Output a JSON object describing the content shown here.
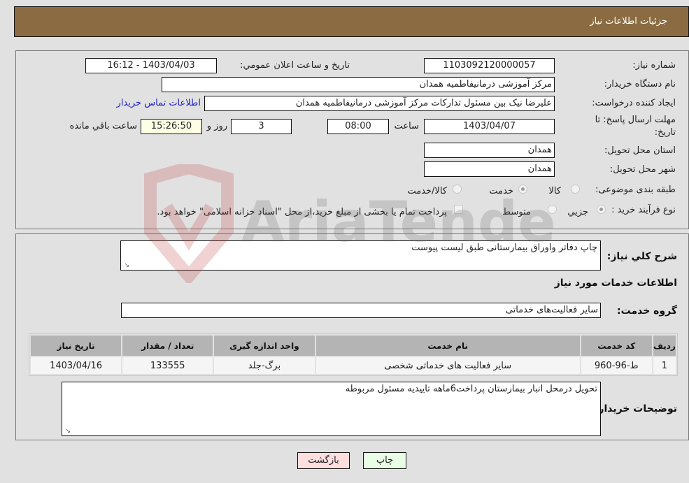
{
  "header": {
    "title": "جزئیات اطلاعات نیاز"
  },
  "fields": {
    "need_number_label": "شماره نیاز:",
    "need_number": "1103092120000057",
    "announce_label": "تاريخ و ساعت اعلان عمومي:",
    "announce_value": "1403/04/03 - 16:12",
    "buyer_org_label": "نام دستگاه خریدار:",
    "buyer_org": "مرکز آموزشی درمانیفاطمیه همدان",
    "creator_label": "ایجاد کننده درخواست:",
    "creator": "علیرضا نیک بین مسئول تدارکات مرکز آموزشی درمانیفاطمیه همدان",
    "contact_link": "اطلاعات تماس خریدار",
    "deadline_label": "مهلت ارسال پاسخ: تا تاریخ:",
    "deadline_date": "1403/04/07",
    "time_label": "ساعت",
    "deadline_time": "08:00",
    "days_value": "3",
    "days_label": "روز و",
    "remaining_time": "15:26:50",
    "remaining_label": "ساعت باقي مانده",
    "province_label": "استان محل تحویل:",
    "province": "همدان",
    "city_label": "شهر محل تحویل:",
    "city": "همدان",
    "category_label": "طبقه بندی موضوعی:",
    "category_options": [
      {
        "label": "کالا",
        "selected": false
      },
      {
        "label": "خدمت",
        "selected": true
      },
      {
        "label": "کالا/خدمت",
        "selected": false
      }
    ],
    "process_label": "نوع فرآیند خرید :",
    "process_options": [
      {
        "label": "جزيي",
        "selected": true
      },
      {
        "label": "متوسط",
        "selected": false
      }
    ],
    "treasury_note": "پرداخت تمام یا بخشی از مبلغ خرید،از محل \"اسناد خزانه اسلامی\" خواهد بود."
  },
  "details": {
    "summary_label": "شرح کلي نياز:",
    "summary": "چاپ دفاتر واوراق بیمارستانی طبق لیست پیوست",
    "services_heading": "اطلاعات خدمات مورد نياز",
    "service_group_label": "گروه خدمت:",
    "service_group": "سایر فعالیت‌های خدماتی",
    "table": {
      "headers": [
        "رديف",
        "کد خدمت",
        "نام خدمت",
        "واحد اندازه گیری",
        "تعداد / مقدار",
        "تاريخ نياز"
      ],
      "rows": [
        [
          "1",
          "ط-96-960",
          "سایر فعالیت های خدماتی شخصی",
          "برگ-جلد",
          "133555",
          "1403/04/16"
        ]
      ]
    },
    "buyer_notes_label": "توضيحات خريدار:",
    "buyer_notes": "تحویل درمحل انبار بیمارستان پرداخت6ماهه تاییدیه مسئول مربوطه"
  },
  "buttons": {
    "print": "چاپ",
    "back": "بازگشت"
  },
  "watermark": {
    "text": "AriaTender.neT"
  },
  "colors": {
    "header_bg": "#8b6c42",
    "link": "#2222cc",
    "back_btn": "#ffdede",
    "print_btn": "#e8ffe6",
    "remaining_bg": "#ffffe6"
  }
}
